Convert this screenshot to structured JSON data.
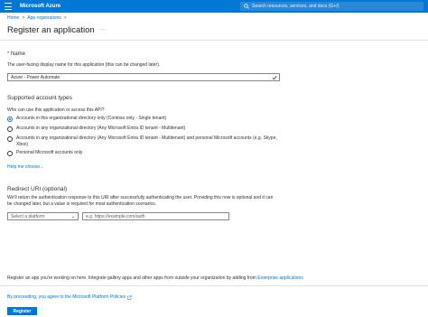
{
  "topbar": {
    "brand": "Microsoft Azure",
    "search_placeholder": "Search resources, services, and docs (G+/)"
  },
  "breadcrumb": {
    "items": [
      "Home",
      "App registrations"
    ],
    "separator": ">"
  },
  "page": {
    "title": "Register an application",
    "more": "···"
  },
  "name_section": {
    "required_mark": "*",
    "label": "Name",
    "help": "The user-facing display name for this application (this can be changed later).",
    "value": "Azure - Power Automate"
  },
  "account_types": {
    "heading": "Supported account types",
    "question": "Who can use this application or access this API?",
    "options": [
      {
        "label": "Accounts in this organizational directory only (Contoso only - Single tenant)",
        "selected": true
      },
      {
        "label": "Accounts in any organizational directory (Any Microsoft Entra ID tenant - Multitenant)",
        "selected": false
      },
      {
        "label": "Accounts in any organizational directory (Any Microsoft Entra ID tenant - Multitenant) and personal Microsoft accounts (e.g. Skype, Xbox)",
        "selected": false
      },
      {
        "label": "Personal Microsoft accounts only",
        "selected": false
      }
    ],
    "help_link": "Help me choose..."
  },
  "redirect": {
    "heading": "Redirect URI (optional)",
    "description": "We'll return the authentication response to this URI after successfully authenticating the user. Providing this now is optional and it can be changed later, but a value is required for most authentication scenarios.",
    "platform_placeholder": "Select a platform",
    "uri_placeholder": "e.g. https://example.com/auth"
  },
  "footer": {
    "info_text": "Register an app you're working on here. Integrate gallery apps and other apps from outside your organization by adding from",
    "info_link": "Enterprise applications",
    "policy_text": "By proceeding, you agree to the Microsoft Platform Policies",
    "register_label": "Register"
  },
  "colors": {
    "accent": "#0078d4",
    "required": "#a4262c",
    "success": "#107c10"
  },
  "icons": [
    "hamburger-icon",
    "search-icon",
    "checkmark-icon",
    "chevron-down-icon",
    "external-link-icon"
  ]
}
